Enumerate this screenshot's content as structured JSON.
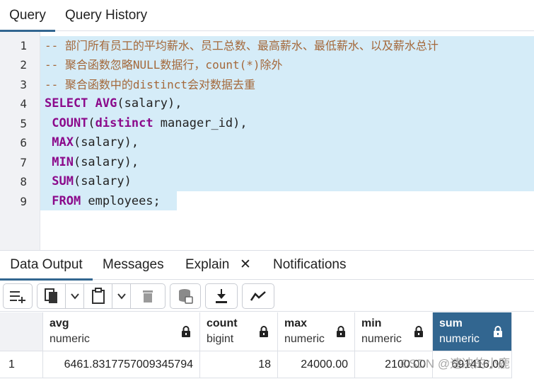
{
  "tabs": {
    "query": "Query",
    "history": "Query History"
  },
  "editor": {
    "line_numbers": [
      "1",
      "2",
      "3",
      "4",
      "5",
      "6",
      "7",
      "8",
      "9"
    ],
    "lines": [
      {
        "parts": [
          {
            "t": "-- 部门所有员工的平均薪水、员工总数、最高薪水、最低薪水、以及薪水总计",
            "c": "cmt"
          }
        ]
      },
      {
        "parts": [
          {
            "t": "-- 聚合函数忽略NULL数据行，count(*)除外",
            "c": "cmt"
          }
        ]
      },
      {
        "parts": [
          {
            "t": "-- 聚合函数中的distinct会对数据去重",
            "c": "cmt"
          }
        ]
      },
      {
        "parts": [
          {
            "t": "SELECT ",
            "c": "kw"
          },
          {
            "t": "AVG",
            "c": "kw"
          },
          {
            "t": "(salary),",
            "c": "sym"
          }
        ]
      },
      {
        "parts": [
          {
            "t": " COUNT",
            "c": "kw"
          },
          {
            "t": "(",
            "c": "sym"
          },
          {
            "t": "distinct",
            "c": "kw"
          },
          {
            "t": " manager_id),",
            "c": "sym"
          }
        ]
      },
      {
        "parts": [
          {
            "t": " MAX",
            "c": "kw"
          },
          {
            "t": "(salary),",
            "c": "sym"
          }
        ]
      },
      {
        "parts": [
          {
            "t": " MIN",
            "c": "kw"
          },
          {
            "t": "(salary),",
            "c": "sym"
          }
        ]
      },
      {
        "parts": [
          {
            "t": " SUM",
            "c": "kw"
          },
          {
            "t": "(salary)",
            "c": "sym"
          }
        ]
      },
      {
        "parts": [
          {
            "t": " FROM",
            "c": "kw"
          },
          {
            "t": " employees;",
            "c": "sym"
          }
        ]
      }
    ]
  },
  "bottom_tabs": {
    "data_output": "Data Output",
    "messages": "Messages",
    "explain": "Explain",
    "explain_close": "✕",
    "notifications": "Notifications"
  },
  "toolbar_icons": [
    "add-row-icon",
    "copy-icon",
    "dropdown-icon",
    "paste-icon",
    "dropdown-icon",
    "delete-icon",
    "save-data-icon",
    "download-icon",
    "graph-icon"
  ],
  "grid": {
    "columns": [
      {
        "name": "avg",
        "type": "numeric"
      },
      {
        "name": "count",
        "type": "bigint"
      },
      {
        "name": "max",
        "type": "numeric"
      },
      {
        "name": "min",
        "type": "numeric"
      },
      {
        "name": "sum",
        "type": "numeric"
      }
    ],
    "rows": [
      {
        "num": "1",
        "cells": [
          "6461.8317757009345794",
          "18",
          "24000.00",
          "2100.00",
          "691416.00"
        ]
      }
    ]
  },
  "watermark": "CSDN @速决的小鹿",
  "colors": {
    "accent": "#326690",
    "selection": "#d5ecf8",
    "keyword": "#8b0a8b",
    "comment": "#a4683a"
  }
}
